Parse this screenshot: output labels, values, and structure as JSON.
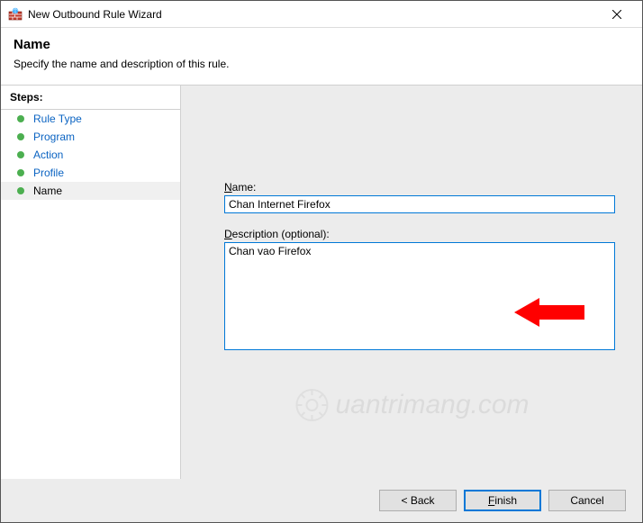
{
  "window": {
    "title": "New Outbound Rule Wizard"
  },
  "header": {
    "title": "Name",
    "subtitle": "Specify the name and description of this rule."
  },
  "sidebar": {
    "header": "Steps:",
    "items": [
      {
        "label": "Rule Type"
      },
      {
        "label": "Program"
      },
      {
        "label": "Action"
      },
      {
        "label": "Profile"
      },
      {
        "label": "Name"
      }
    ]
  },
  "form": {
    "name_label_ul": "N",
    "name_label_rest": "ame:",
    "name_value": "Chan Internet Firefox",
    "desc_label_ul": "D",
    "desc_label_rest": "escription (optional):",
    "desc_value": "Chan vao Firefox"
  },
  "footer": {
    "back": "< Back",
    "finish_ul": "F",
    "finish_rest": "inish",
    "cancel": "Cancel"
  },
  "watermark": "uantrimang.com"
}
